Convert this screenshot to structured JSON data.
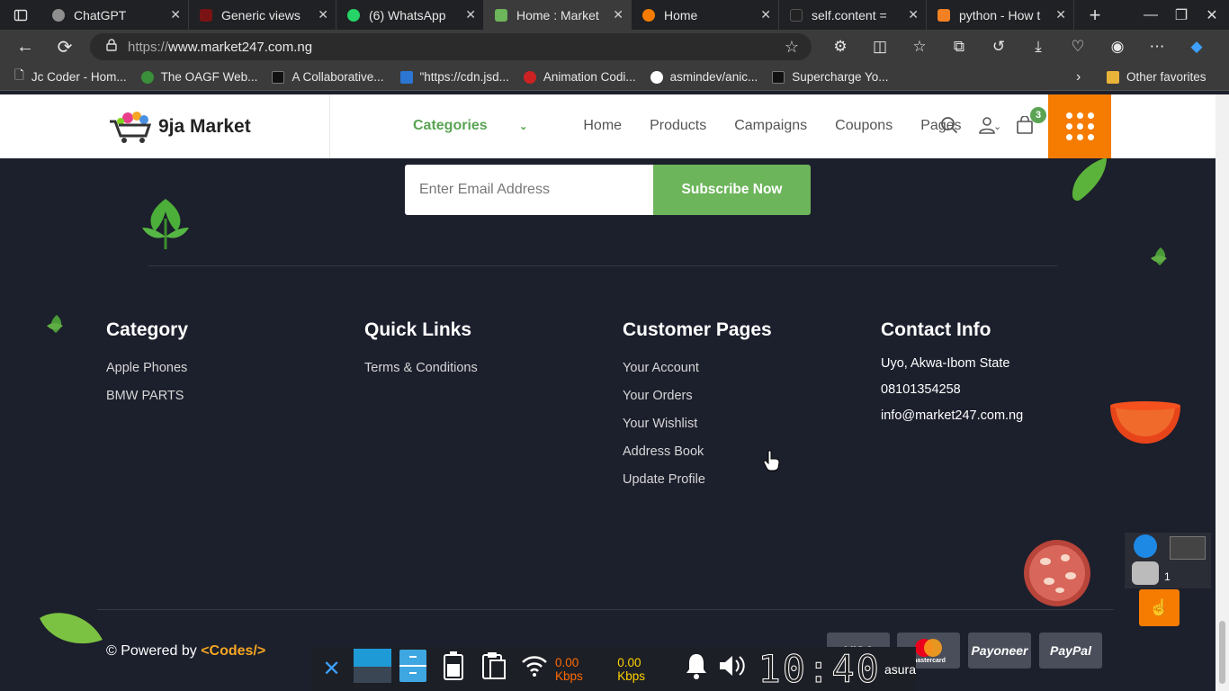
{
  "browser": {
    "tabs": [
      {
        "title": "ChatGPT",
        "color": "#8e8e8e",
        "icon": "chatgpt-icon"
      },
      {
        "title": "Generic views",
        "color": "#7a1414",
        "icon": "django-icon"
      },
      {
        "title": "(6) WhatsApp",
        "color": "#25d366",
        "icon": "whatsapp-icon"
      },
      {
        "title": "Home : Market",
        "color": "#6db55b",
        "icon": "market-icon"
      },
      {
        "title": "Home",
        "color": "#f57c00",
        "icon": "headphones-icon"
      },
      {
        "title": "self.content = ",
        "color": "#222222",
        "icon": "search-icon"
      },
      {
        "title": "python - How t",
        "color": "#f48024",
        "icon": "stackoverflow-icon"
      }
    ],
    "url_prefix": "https://",
    "url_host": "www.market247.com.ng",
    "bookmarks": [
      {
        "label": "Jc Coder - Hom...",
        "color": "#dddddd"
      },
      {
        "label": "The OAGF Web...",
        "color": "#3a8f3a"
      },
      {
        "label": "A Collaborative...",
        "color": "#111111"
      },
      {
        "label": "\"https://cdn.jsd...",
        "color": "#2b76d2"
      },
      {
        "label": "Animation Codi...",
        "color": "#cc2222"
      },
      {
        "label": "asmindev/anic...",
        "color": "#ffffff"
      },
      {
        "label": "Supercharge Yo...",
        "color": "#111111"
      }
    ],
    "other_favorites": "Other favorites"
  },
  "site": {
    "logo_text": "9ja Market",
    "nav": {
      "categories": "Categories",
      "home": "Home",
      "products": "Products",
      "campaigns": "Campaigns",
      "coupons": "Coupons",
      "pages": "Pages"
    },
    "cart_count": "3",
    "accent_orange": "#f57c00",
    "accent_green": "#6db55b"
  },
  "newsletter": {
    "placeholder": "Enter Email Address",
    "button": "Subscribe Now"
  },
  "footer": {
    "category": {
      "heading": "Category",
      "items": [
        "Apple Phones",
        "BMW PARTS"
      ]
    },
    "quick_links": {
      "heading": "Quick Links",
      "items": [
        "Terms & Conditions"
      ]
    },
    "customer_pages": {
      "heading": "Customer Pages",
      "items": [
        "Your Account",
        "Your Orders",
        "Your Wishlist",
        "Address Book",
        "Update Profile"
      ]
    },
    "contact": {
      "heading": "Contact Info",
      "address": "Uyo, Akwa-Ibom State",
      "phone": "08101354258",
      "email": "info@market247.com.ng"
    },
    "powered_by": "© Powered by",
    "codes_brand": "<Codes/>",
    "payments": [
      "VISA",
      "mastercard",
      "Payoneer",
      "PayPal"
    ]
  },
  "taskbar": {
    "net_down": "0.00 Kbps",
    "net_up": "0.00 Kbps",
    "clock": "10:40",
    "label": "asura",
    "tray_count": "1"
  }
}
